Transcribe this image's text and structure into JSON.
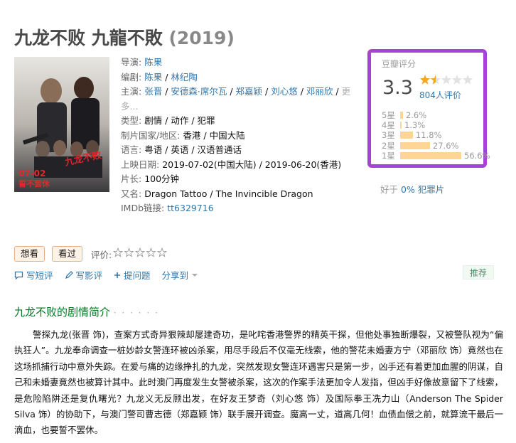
{
  "movie": {
    "title": "九龙不败 九龍不敗",
    "year": "(2019)"
  },
  "info": {
    "director_label": "导演:",
    "director": "陈果",
    "writer_label": "编剧:",
    "writers": [
      "陈果",
      "林纪陶"
    ],
    "cast_label": "主演:",
    "cast": [
      "张晋",
      "安德森·席尔瓦",
      "郑嘉颖",
      "刘心悠",
      "邓丽欣"
    ],
    "cast_more": "更多...",
    "genre_label": "类型:",
    "genres": "剧情 / 动作 / 犯罪",
    "country_label": "制片国家/地区:",
    "country": "香港 / 中国大陆",
    "language_label": "语言:",
    "language": "粤语 / 英语 / 汉语普通话",
    "release_label": "上映日期:",
    "release": "2019-07-02(中国大陆) / 2019-06-20(香港)",
    "runtime_label": "片长:",
    "runtime": "100分钟",
    "aka_label": "又名:",
    "aka": "Dragon Tattoo / The Invincible Dragon",
    "imdb_label": "IMDb链接:",
    "imdb": "tt6329716"
  },
  "rating": {
    "title": "豆瓣评分",
    "score": "3.3",
    "stars_value": 1.5,
    "count": "804人评价",
    "breakdown": [
      {
        "label": "5星",
        "percent": 2.6,
        "text": "2.6%"
      },
      {
        "label": "4星",
        "percent": 1.3,
        "text": "1.3%"
      },
      {
        "label": "3星",
        "percent": 11.8,
        "text": "11.8%"
      },
      {
        "label": "2星",
        "percent": 27.6,
        "text": "27.6%"
      },
      {
        "label": "1星",
        "percent": 56.6,
        "text": "56.6%"
      }
    ],
    "better_prefix": "好于",
    "better_link": "0% 犯罪片"
  },
  "actions": {
    "want": "想看",
    "seen": "看过",
    "rate_label": "评价:"
  },
  "links": {
    "short_review": "写短评",
    "review": "写影评",
    "question": "提问题",
    "share": "分享到",
    "recommend": "推荐"
  },
  "synopsis": {
    "heading": "九龙不败的剧情简介",
    "dots": "· · · · · ·",
    "text": "警探九龙(张晋 饰)，查案方式奇异狠辣却屡建奇功，是叱咤香港警界的精英干探，但他处事独断爆裂，又被警队视为“偏执狂人”。九龙奉命调查一桩妙龄女警连环被凶杀案，用尽手段后不仅毫无线索，他的警花未婚妻方宁（邓丽欣 饰）竟然也在这场抓捕行动中意外失踪。在爱与痛的边缘挣扎的九龙，突然发现女警连环遇害只是第一步，凶手还有着更加血腥的阴谋，自己和未婚妻竟然也被算计其中。此时澳门再度发生女警被杀案，这次的作案手法更加令人发指，但凶手好像故意留下了线索，是危险陷阱还是复仇曙光？九龙义无反顾出发，在好友王梦奇（刘心悠 饰）及国际拳王冼力山（Anderson The Spider Silva 饰）的协助下，与澳门警司曹志德（郑嘉颖 饰）联手展开调查。魔高一丈，道高几何！血债血偿之前，就算流干最后一滴血，也要誓不罢休。"
  },
  "poster": {
    "date": "07-02",
    "slogan": "誓不罢休"
  },
  "colors": {
    "highlight_border": "#a443d9",
    "link": "#37a",
    "bar_fill": "#ffd596",
    "section_green": "#007722"
  }
}
